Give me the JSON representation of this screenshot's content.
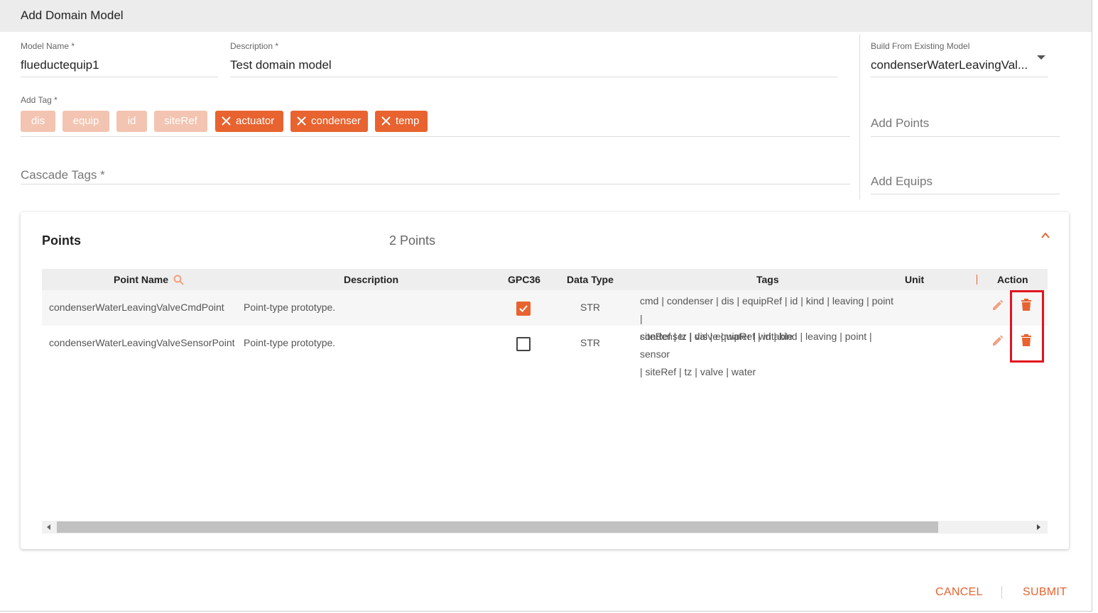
{
  "dialog": {
    "title": "Add Domain Model"
  },
  "form": {
    "model_name": {
      "label": "Model Name *",
      "value": "flueductequip1"
    },
    "description": {
      "label": "Description *",
      "value": "Test domain model"
    },
    "build_from": {
      "label": "Build From Existing Model",
      "value": "condenserWaterLeavingVal..."
    },
    "add_tag": {
      "label": "Add Tag *",
      "inherited_tags": [
        "dis",
        "equip",
        "id",
        "siteRef"
      ],
      "removable_tags": [
        "actuator",
        "condenser",
        "temp"
      ]
    },
    "cascade_tags": {
      "placeholder": "Cascade Tags *"
    },
    "add_points": {
      "placeholder": "Add Points"
    },
    "add_equips": {
      "placeholder": "Add Equips"
    }
  },
  "points_card": {
    "title": "Points",
    "count_text": "2 Points",
    "columns": [
      "Point Name",
      "Description",
      "GPC36",
      "Data Type",
      "Tags",
      "Unit",
      "Action"
    ],
    "rows": [
      {
        "point_name": "condenserWaterLeavingValveCmdPoint",
        "description": "Point-type prototype.",
        "gpc36": true,
        "data_type": "STR",
        "tags_line1": "cmd | condenser | dis | equipRef | id | kind | leaving | point |",
        "tags_line2": "siteRef | tz | valve | water | writable",
        "unit": ""
      },
      {
        "point_name": "condenserWaterLeavingValveSensorPoint",
        "description": "Point-type prototype.",
        "gpc36": false,
        "data_type": "STR",
        "tags_line1": "condenser | dis | equipRef | id | kind | leaving | point | sensor",
        "tags_line2": "| siteRef | tz | valve | water",
        "unit": ""
      }
    ]
  },
  "footer": {
    "cancel_label": "CANCEL",
    "submit_label": "SUBMIT"
  },
  "colors": {
    "accent": "#e8632f",
    "inherited_tag": "#f3c4b1",
    "highlight": "#e0141e"
  }
}
